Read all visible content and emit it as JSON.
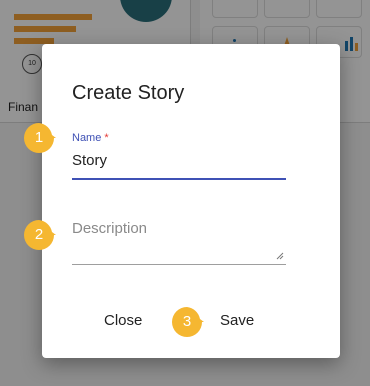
{
  "background": {
    "card_label": "Finan",
    "badge_text": "10",
    "accent_color": "#f5a33a",
    "teal_color": "#2a6f7a"
  },
  "dialog": {
    "title": "Create Story",
    "name_field": {
      "label": "Name",
      "required_mark": "*",
      "value": "Story"
    },
    "description_field": {
      "placeholder": "Description",
      "value": ""
    },
    "buttons": {
      "close_label": "Close",
      "save_label": "Save"
    },
    "primary_color": "#3f51b5"
  },
  "callouts": {
    "one": "1",
    "two": "2",
    "three": "3",
    "color": "#f5b731"
  }
}
